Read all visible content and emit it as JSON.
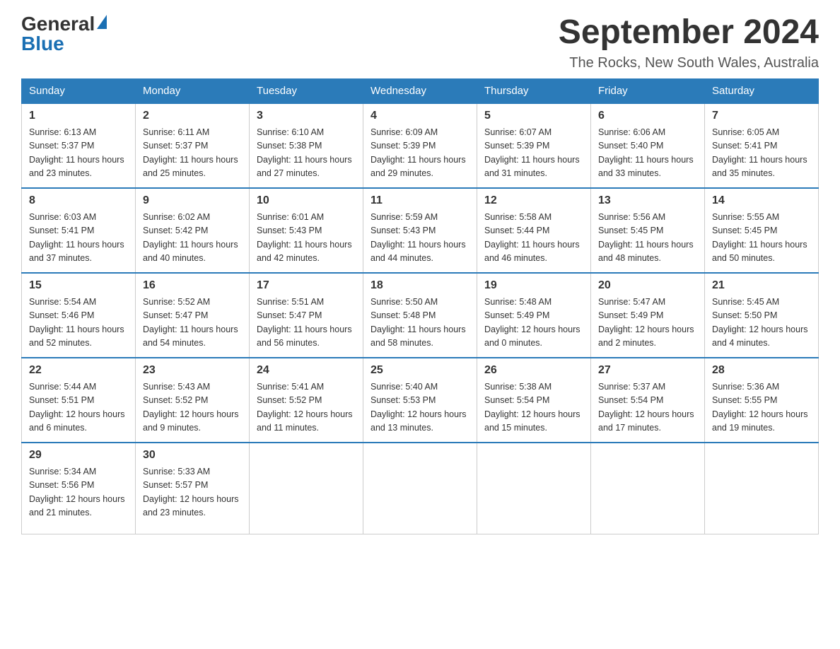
{
  "header": {
    "logo_line1": "General",
    "logo_line2": "Blue",
    "month_title": "September 2024",
    "location": "The Rocks, New South Wales, Australia"
  },
  "days_of_week": [
    "Sunday",
    "Monday",
    "Tuesday",
    "Wednesday",
    "Thursday",
    "Friday",
    "Saturday"
  ],
  "weeks": [
    [
      {
        "day": "1",
        "sunrise": "6:13 AM",
        "sunset": "5:37 PM",
        "daylight": "11 hours and 23 minutes."
      },
      {
        "day": "2",
        "sunrise": "6:11 AM",
        "sunset": "5:37 PM",
        "daylight": "11 hours and 25 minutes."
      },
      {
        "day": "3",
        "sunrise": "6:10 AM",
        "sunset": "5:38 PM",
        "daylight": "11 hours and 27 minutes."
      },
      {
        "day": "4",
        "sunrise": "6:09 AM",
        "sunset": "5:39 PM",
        "daylight": "11 hours and 29 minutes."
      },
      {
        "day": "5",
        "sunrise": "6:07 AM",
        "sunset": "5:39 PM",
        "daylight": "11 hours and 31 minutes."
      },
      {
        "day": "6",
        "sunrise": "6:06 AM",
        "sunset": "5:40 PM",
        "daylight": "11 hours and 33 minutes."
      },
      {
        "day": "7",
        "sunrise": "6:05 AM",
        "sunset": "5:41 PM",
        "daylight": "11 hours and 35 minutes."
      }
    ],
    [
      {
        "day": "8",
        "sunrise": "6:03 AM",
        "sunset": "5:41 PM",
        "daylight": "11 hours and 37 minutes."
      },
      {
        "day": "9",
        "sunrise": "6:02 AM",
        "sunset": "5:42 PM",
        "daylight": "11 hours and 40 minutes."
      },
      {
        "day": "10",
        "sunrise": "6:01 AM",
        "sunset": "5:43 PM",
        "daylight": "11 hours and 42 minutes."
      },
      {
        "day": "11",
        "sunrise": "5:59 AM",
        "sunset": "5:43 PM",
        "daylight": "11 hours and 44 minutes."
      },
      {
        "day": "12",
        "sunrise": "5:58 AM",
        "sunset": "5:44 PM",
        "daylight": "11 hours and 46 minutes."
      },
      {
        "day": "13",
        "sunrise": "5:56 AM",
        "sunset": "5:45 PM",
        "daylight": "11 hours and 48 minutes."
      },
      {
        "day": "14",
        "sunrise": "5:55 AM",
        "sunset": "5:45 PM",
        "daylight": "11 hours and 50 minutes."
      }
    ],
    [
      {
        "day": "15",
        "sunrise": "5:54 AM",
        "sunset": "5:46 PM",
        "daylight": "11 hours and 52 minutes."
      },
      {
        "day": "16",
        "sunrise": "5:52 AM",
        "sunset": "5:47 PM",
        "daylight": "11 hours and 54 minutes."
      },
      {
        "day": "17",
        "sunrise": "5:51 AM",
        "sunset": "5:47 PM",
        "daylight": "11 hours and 56 minutes."
      },
      {
        "day": "18",
        "sunrise": "5:50 AM",
        "sunset": "5:48 PM",
        "daylight": "11 hours and 58 minutes."
      },
      {
        "day": "19",
        "sunrise": "5:48 AM",
        "sunset": "5:49 PM",
        "daylight": "12 hours and 0 minutes."
      },
      {
        "day": "20",
        "sunrise": "5:47 AM",
        "sunset": "5:49 PM",
        "daylight": "12 hours and 2 minutes."
      },
      {
        "day": "21",
        "sunrise": "5:45 AM",
        "sunset": "5:50 PM",
        "daylight": "12 hours and 4 minutes."
      }
    ],
    [
      {
        "day": "22",
        "sunrise": "5:44 AM",
        "sunset": "5:51 PM",
        "daylight": "12 hours and 6 minutes."
      },
      {
        "day": "23",
        "sunrise": "5:43 AM",
        "sunset": "5:52 PM",
        "daylight": "12 hours and 9 minutes."
      },
      {
        "day": "24",
        "sunrise": "5:41 AM",
        "sunset": "5:52 PM",
        "daylight": "12 hours and 11 minutes."
      },
      {
        "day": "25",
        "sunrise": "5:40 AM",
        "sunset": "5:53 PM",
        "daylight": "12 hours and 13 minutes."
      },
      {
        "day": "26",
        "sunrise": "5:38 AM",
        "sunset": "5:54 PM",
        "daylight": "12 hours and 15 minutes."
      },
      {
        "day": "27",
        "sunrise": "5:37 AM",
        "sunset": "5:54 PM",
        "daylight": "12 hours and 17 minutes."
      },
      {
        "day": "28",
        "sunrise": "5:36 AM",
        "sunset": "5:55 PM",
        "daylight": "12 hours and 19 minutes."
      }
    ],
    [
      {
        "day": "29",
        "sunrise": "5:34 AM",
        "sunset": "5:56 PM",
        "daylight": "12 hours and 21 minutes."
      },
      {
        "day": "30",
        "sunrise": "5:33 AM",
        "sunset": "5:57 PM",
        "daylight": "12 hours and 23 minutes."
      },
      null,
      null,
      null,
      null,
      null
    ]
  ],
  "labels": {
    "sunrise_prefix": "Sunrise: ",
    "sunset_prefix": "Sunset: ",
    "daylight_prefix": "Daylight: "
  }
}
